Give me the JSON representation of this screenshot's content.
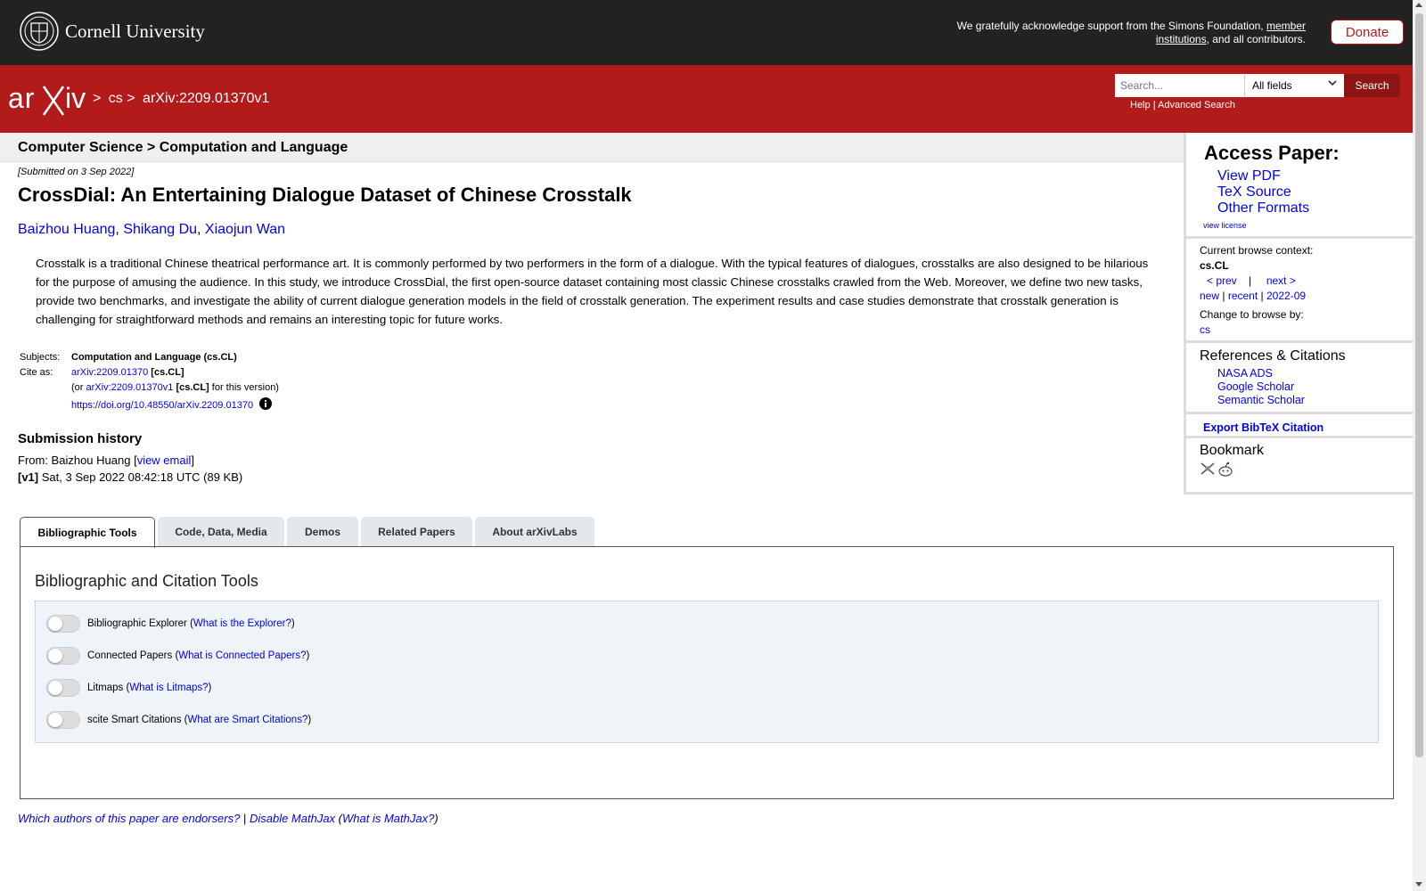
{
  "header": {
    "university": "Cornell University",
    "support_text": "We gratefully acknowledge support from the Simons Foundation,",
    "support_link": "member institutions",
    "support_tail": ", and all contributors.",
    "donate": "Donate"
  },
  "nav": {
    "logo_text": "arXiv",
    "crumbs": [
      ">",
      "cs",
      ">",
      "arXiv:2209.01370v1"
    ],
    "search_placeholder": "Search...",
    "search_field": "All fields",
    "search_button": "Search",
    "help": "Help",
    "sep": "|",
    "advanced": "Advanced Search"
  },
  "subheader": "Computer Science > Computation and Language",
  "paper": {
    "submitted": "[Submitted on 3 Sep 2022]",
    "title": "CrossDial: An Entertaining Dialogue Dataset of Chinese Crosstalk",
    "authors": [
      "Baizhou Huang",
      "Shikang Du",
      "Xiaojun Wan"
    ],
    "abstract": "Crosstalk is a traditional Chinese theatrical performance art. It is commonly performed by two performers in the form of a dialogue. With the typical features of dialogues, crosstalks are also designed to be hilarious for the purpose of amusing the audience. In this study, we introduce CrossDial, the first open-source dataset containing most classic Chinese crosstalks crawled from the Web. Moreover, we define two new tasks, provide two benchmarks, and investigate the ability of current dialogue generation models in the field of crosstalk generation. The experiment results and case studies demonstrate that crosstalk generation is challenging for straightforward methods and remains an interesting topic for future works.",
    "subjects_label": "Subjects:",
    "subjects": "Computation and Language (cs.CL)",
    "cite_label": "Cite as:",
    "cite_id": "arXiv:2209.01370",
    "cite_cat": "[cs.CL]",
    "cite_or": "(or",
    "cite_version_id": "arXiv:2209.01370v1",
    "cite_version_cat": "[cs.CL]",
    "cite_version_tail": "for this version)",
    "doi": "https://doi.org/10.48550/arXiv.2209.01370",
    "history_title": "Submission history",
    "from_label": "From: Baizhou Huang [",
    "view_email": "view email",
    "from_close": "]",
    "v1_label": "[v1]",
    "v1_text": "Sat, 3 Sep 2022 08:42:18 UTC (89 KB)"
  },
  "sidebar": {
    "access_title": "Access Paper:",
    "view_pdf": "View PDF",
    "tex_source": "TeX Source",
    "other_formats": "Other Formats",
    "view_license": "view license",
    "context_label": "Current browse context:",
    "context": "cs.CL",
    "prev": "< prev",
    "pipe": "|",
    "next": "next >",
    "new": "new",
    "recent": "recent",
    "month": "2022-09",
    "change_label": "Change to browse by:",
    "change_cs": "cs",
    "refs_title": "References & Citations",
    "refs": [
      "NASA ADS",
      "Google Scholar",
      "Semantic Scholar"
    ],
    "bibtex": "Export BibTeX Citation",
    "bookmark": "Bookmark"
  },
  "tabs": [
    "Bibliographic Tools",
    "Code, Data, Media",
    "Demos",
    "Related Papers",
    "About arXivLabs"
  ],
  "panel": {
    "title": "Bibliographic and Citation Tools",
    "tools": [
      {
        "name": "Bibliographic Explorer",
        "link": "What is the Explorer?"
      },
      {
        "name": "Connected Papers",
        "link": "What is Connected Papers?"
      },
      {
        "name": "Litmaps",
        "link": "What is Litmaps?"
      },
      {
        "name": "scite Smart Citations",
        "link": "What are Smart Citations?"
      }
    ]
  },
  "footer": {
    "endorsers": "Which authors of this paper are endorsers?",
    "sep": "|",
    "disable_mathjax": "Disable MathJax",
    "what_mathjax": "What is MathJax?"
  },
  "colors": {
    "brand_red": "#b31b1b",
    "link": "#0000ee",
    "header_dark": "#222222"
  }
}
